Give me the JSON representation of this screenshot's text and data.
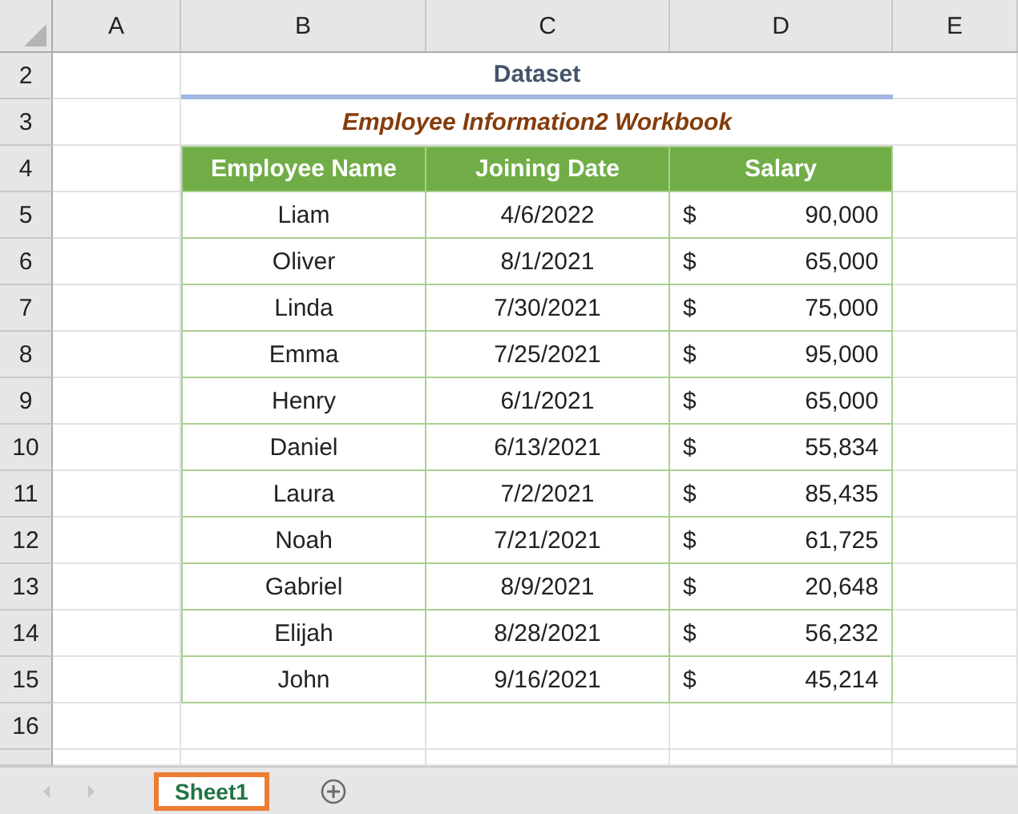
{
  "columns": [
    "A",
    "B",
    "C",
    "D",
    "E"
  ],
  "row_numbers": [
    "2",
    "3",
    "4",
    "5",
    "6",
    "7",
    "8",
    "9",
    "10",
    "11",
    "12",
    "13",
    "14",
    "15",
    "16"
  ],
  "title": "Dataset",
  "subtitle": "Employee Information2 Workbook",
  "table": {
    "columns": [
      "Employee Name",
      "Joining Date",
      "Salary"
    ],
    "rows": [
      {
        "name": "Liam",
        "date": "4/6/2022",
        "currency": "$",
        "salary": "90,000"
      },
      {
        "name": "Oliver",
        "date": "8/1/2021",
        "currency": "$",
        "salary": "65,000"
      },
      {
        "name": "Linda",
        "date": "7/30/2021",
        "currency": "$",
        "salary": "75,000"
      },
      {
        "name": "Emma",
        "date": "7/25/2021",
        "currency": "$",
        "salary": "95,000"
      },
      {
        "name": "Henry",
        "date": "6/1/2021",
        "currency": "$",
        "salary": "65,000"
      },
      {
        "name": "Daniel",
        "date": "6/13/2021",
        "currency": "$",
        "salary": "55,834"
      },
      {
        "name": "Laura",
        "date": "7/2/2021",
        "currency": "$",
        "salary": "85,435"
      },
      {
        "name": "Noah",
        "date": "7/21/2021",
        "currency": "$",
        "salary": "61,725"
      },
      {
        "name": "Gabriel",
        "date": "8/9/2021",
        "currency": "$",
        "salary": "20,648"
      },
      {
        "name": "Elijah",
        "date": "8/28/2021",
        "currency": "$",
        "salary": "56,232"
      },
      {
        "name": "John",
        "date": "9/16/2021",
        "currency": "$",
        "salary": "45,214"
      }
    ]
  },
  "sheet_tabs": [
    {
      "label": "Sheet1",
      "selected": true
    }
  ]
}
